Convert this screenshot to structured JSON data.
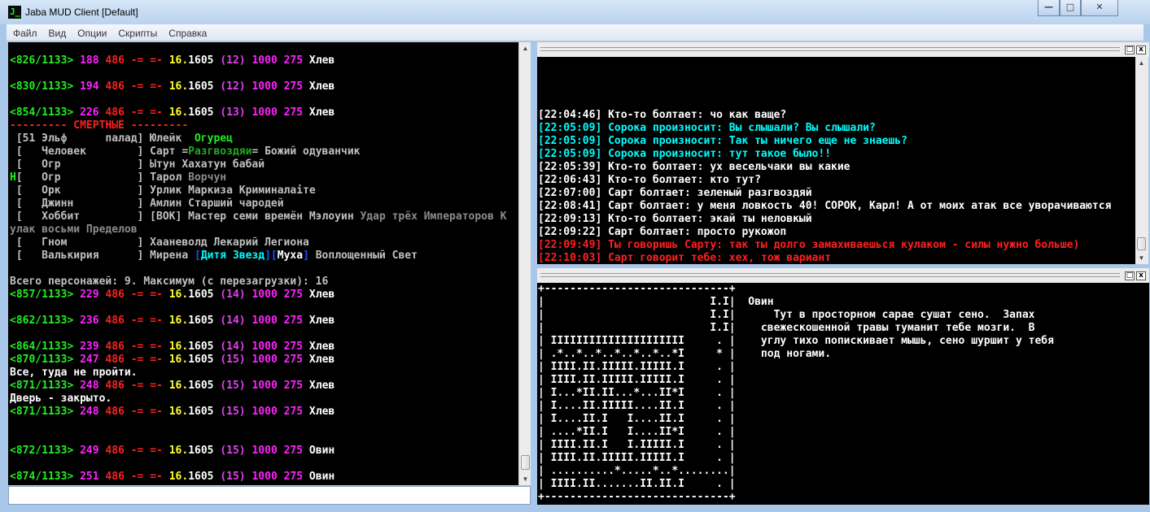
{
  "window": {
    "title": "Jaba MUD Client [Default]",
    "app_icon": "J_",
    "minimize": "—",
    "maximize": "□",
    "close": "✕"
  },
  "menu": [
    "Файл",
    "Вид",
    "Опции",
    "Скрипты",
    "Справка"
  ],
  "palette": {
    "G": "#22ee22",
    "DG": "#22aa22",
    "M": "#ff22ff",
    "V": "#e040f0",
    "R": "#ff2020",
    "Y": "#ffff33",
    "W": "#ffffff",
    "L": "#c0c0c0",
    "D": "#8c8c8c",
    "C": "#00ffff",
    "B": "#2050ff"
  },
  "main_output": [
    [
      [
        "<826/1133>",
        "G"
      ],
      [
        " 188",
        "M"
      ],
      [
        " 486 -= =-",
        "R"
      ],
      [
        " 16.",
        "Y"
      ],
      [
        "1605",
        "W"
      ],
      [
        " (12)",
        "V"
      ],
      [
        " 1000 275",
        "M"
      ],
      [
        " Хлев",
        "W"
      ]
    ],
    [],
    [
      [
        "<830/1133>",
        "G"
      ],
      [
        " 194",
        "M"
      ],
      [
        " 486 -= =-",
        "R"
      ],
      [
        " 16.",
        "Y"
      ],
      [
        "1605",
        "W"
      ],
      [
        " (12)",
        "V"
      ],
      [
        " 1000 275",
        "M"
      ],
      [
        " Хлев",
        "W"
      ]
    ],
    [],
    [
      [
        "<854/1133>",
        "G"
      ],
      [
        " 226",
        "M"
      ],
      [
        " 486 -= =-",
        "R"
      ],
      [
        " 16.",
        "Y"
      ],
      [
        "1605",
        "W"
      ],
      [
        " (13)",
        "V"
      ],
      [
        " 1000 275",
        "M"
      ],
      [
        " Хлев",
        "W"
      ]
    ],
    [
      [
        "--------- СМЕРТНЫЕ ---------",
        "R"
      ]
    ],
    [
      [
        " [51 Эльф      палад] Юлейк  ",
        "L"
      ],
      [
        "Огурец",
        "G"
      ]
    ],
    [
      [
        " [   Человек        ] Сарт =",
        "L"
      ],
      [
        "Разгвоздяи",
        "DG"
      ],
      [
        "= Божий одуванчик",
        "L"
      ]
    ],
    [
      [
        " [   Огр            ] Ытун Хахатун бабай",
        "L"
      ]
    ],
    [
      [
        "Н",
        "G"
      ],
      [
        "[   Огр            ] Тарол ",
        "L"
      ],
      [
        "Ворчун",
        "D"
      ]
    ],
    [
      [
        " [   Орк            ] Урлик Маркиза Криминалаiте",
        "L"
      ]
    ],
    [
      [
        " [   Джинн          ] Амлин Старший чародей",
        "L"
      ]
    ],
    [
      [
        " [   Хоббит         ] [ВОК] Мастер семи времён Мэлоуин ",
        "L"
      ],
      [
        "Удар трёх Императоров К",
        "D"
      ]
    ],
    [
      [
        "улак восьми Пределов",
        "D"
      ]
    ],
    [
      [
        " [   Гном           ] Хааневолд Лекарий Легиона",
        "L"
      ]
    ],
    [
      [
        " [   Валькирия      ] Мирена ",
        "L"
      ],
      [
        "[",
        "B"
      ],
      [
        "Дитя Звезд",
        "C"
      ],
      [
        "]",
        "B"
      ],
      [
        "[",
        "B"
      ],
      [
        "Муха",
        "W"
      ],
      [
        "]",
        "B"
      ],
      [
        " Воплощенный Свет",
        "L"
      ]
    ],
    [],
    [
      [
        "Всего персонажей: 9. Максимум (с перезагрузки): 16",
        "L"
      ]
    ],
    [
      [
        "<857/1133>",
        "G"
      ],
      [
        " 229",
        "M"
      ],
      [
        " 486 -= =-",
        "R"
      ],
      [
        " 16.",
        "Y"
      ],
      [
        "1605",
        "W"
      ],
      [
        " (14)",
        "V"
      ],
      [
        " 1000 275",
        "M"
      ],
      [
        " Хлев",
        "W"
      ]
    ],
    [],
    [
      [
        "<862/1133>",
        "G"
      ],
      [
        " 236",
        "M"
      ],
      [
        " 486 -= =-",
        "R"
      ],
      [
        " 16.",
        "Y"
      ],
      [
        "1605",
        "W"
      ],
      [
        " (14)",
        "V"
      ],
      [
        " 1000 275",
        "M"
      ],
      [
        " Хлев",
        "W"
      ]
    ],
    [],
    [
      [
        "<864/1133>",
        "G"
      ],
      [
        " 239",
        "M"
      ],
      [
        " 486 -= =-",
        "R"
      ],
      [
        " 16.",
        "Y"
      ],
      [
        "1605",
        "W"
      ],
      [
        " (14)",
        "V"
      ],
      [
        " 1000 275",
        "M"
      ],
      [
        " Хлев",
        "W"
      ]
    ],
    [
      [
        "<870/1133>",
        "G"
      ],
      [
        " 247",
        "M"
      ],
      [
        " 486 -= =-",
        "R"
      ],
      [
        " 16.",
        "Y"
      ],
      [
        "1605",
        "W"
      ],
      [
        " (15)",
        "V"
      ],
      [
        " 1000 275",
        "M"
      ],
      [
        " Хлев",
        "W"
      ]
    ],
    [
      [
        "Все, туда не пройти.",
        "W"
      ]
    ],
    [
      [
        "<871/1133>",
        "G"
      ],
      [
        " 248",
        "M"
      ],
      [
        " 486 -= =-",
        "R"
      ],
      [
        " 16.",
        "Y"
      ],
      [
        "1605",
        "W"
      ],
      [
        " (15)",
        "V"
      ],
      [
        " 1000 275",
        "M"
      ],
      [
        " Хлев",
        "W"
      ]
    ],
    [
      [
        "Дверь - закрыто.",
        "W"
      ]
    ],
    [
      [
        "<871/1133>",
        "G"
      ],
      [
        " 248",
        "M"
      ],
      [
        " 486 -= =-",
        "R"
      ],
      [
        " 16.",
        "Y"
      ],
      [
        "1605",
        "W"
      ],
      [
        " (15)",
        "V"
      ],
      [
        " 1000 275",
        "M"
      ],
      [
        " Хлев",
        "W"
      ]
    ],
    [],
    [],
    [
      [
        "<872/1133>",
        "G"
      ],
      [
        " 249",
        "M"
      ],
      [
        " 486 -= =-",
        "R"
      ],
      [
        " 16.",
        "Y"
      ],
      [
        "1605",
        "W"
      ],
      [
        " (15)",
        "V"
      ],
      [
        " 1000 275",
        "M"
      ],
      [
        " Овин",
        "W"
      ]
    ],
    [],
    [
      [
        "<874/1133>",
        "G"
      ],
      [
        " 251",
        "M"
      ],
      [
        " 486 -= =-",
        "R"
      ],
      [
        " 16.",
        "Y"
      ],
      [
        "1605",
        "W"
      ],
      [
        " (15)",
        "V"
      ],
      [
        " 1000 275",
        "M"
      ],
      [
        " Овин",
        "W"
      ]
    ]
  ],
  "chat_log": [
    [
      [
        "[22:04:46] Кто-то болтает: чо как ваще?",
        "W"
      ]
    ],
    [
      [
        "[22:05:09] Сорока произносит: Вы слышали? Вы слышали?",
        "C"
      ]
    ],
    [
      [
        "[22:05:09] Сорока произносит: Так ты ничего еще не знаешь?",
        "C"
      ]
    ],
    [
      [
        "[22:05:09] Сорока произносит: тут такое было!!",
        "C"
      ]
    ],
    [
      [
        "[22:05:39] Кто-то болтает: ух весельчаки вы какие",
        "W"
      ]
    ],
    [
      [
        "[22:06:43] Кто-то болтает: кто тут?",
        "W"
      ]
    ],
    [
      [
        "[22:07:00] Сарт болтает: зеленый разгвоздяй",
        "W"
      ]
    ],
    [
      [
        "[22:08:41] Сарт болтает: у меня ловкость 40! СОРОК, Карл! А от моих атак все уворачиваются",
        "W"
      ]
    ],
    [
      [
        "[22:09:13] Кто-то болтает: экай ты неловкый",
        "W"
      ]
    ],
    [
      [
        "[22:09:22] Сарт болтает: просто рукожоп",
        "W"
      ]
    ],
    [
      [
        "[22:09:49] Ты говоришь Сарту: так ты долго замахиваешься кулаком - силы нужно больше)",
        "R"
      ]
    ],
    [
      [
        "[22:10:03] Сарт говорит тебе: хех, тож вариант",
        "R"
      ]
    ]
  ],
  "room_view": [
    [
      [
        "+-----------------------------+",
        "W"
      ]
    ],
    [
      [
        "|                          I.I|  Овин",
        "W"
      ]
    ],
    [
      [
        "|                          I.I|      Тут в просторном сарае сушат сено.  Запах",
        "W"
      ]
    ],
    [
      [
        "|                          I.I|    свежескошенной травы туманит тебе мозги.  В",
        "W"
      ]
    ],
    [
      [
        "| IIIIIIIIIIIIIIIIIIIII     . |    углу тихо попискивает мышь, сено шуршит у тебя",
        "W"
      ]
    ],
    [
      [
        "| .*..*..*..*..*..*..*I     * |    под ногами.",
        "W"
      ]
    ],
    [
      [
        "| IIII.II.IIIII.IIIII.I     . |",
        "W"
      ]
    ],
    [
      [
        "| IIII.II.IIIII.IIIII.I     . |",
        "W"
      ]
    ],
    [
      [
        "| I...*II.II...*...II*I     . |",
        "W"
      ]
    ],
    [
      [
        "| I....II.IIIII....II.I     . |",
        "W"
      ]
    ],
    [
      [
        "| I....II.I   I....II.I     . |",
        "W"
      ]
    ],
    [
      [
        "| ....*II.I   I....II*I     . |",
        "W"
      ]
    ],
    [
      [
        "| IIII.II.I   I.IIIII.I     . |",
        "W"
      ]
    ],
    [
      [
        "| IIII.II.IIIII.IIIII.I     . |",
        "W"
      ]
    ],
    [
      [
        "| ..........*.....*..*........|",
        "W"
      ]
    ],
    [
      [
        "| IIII.II.......II.II.I     . |",
        "W"
      ]
    ],
    [
      [
        "+-----------------------------+",
        "W"
      ]
    ]
  ],
  "command_input": {
    "value": ""
  },
  "pane_buttons": {
    "maximize": "□",
    "close": "x"
  }
}
